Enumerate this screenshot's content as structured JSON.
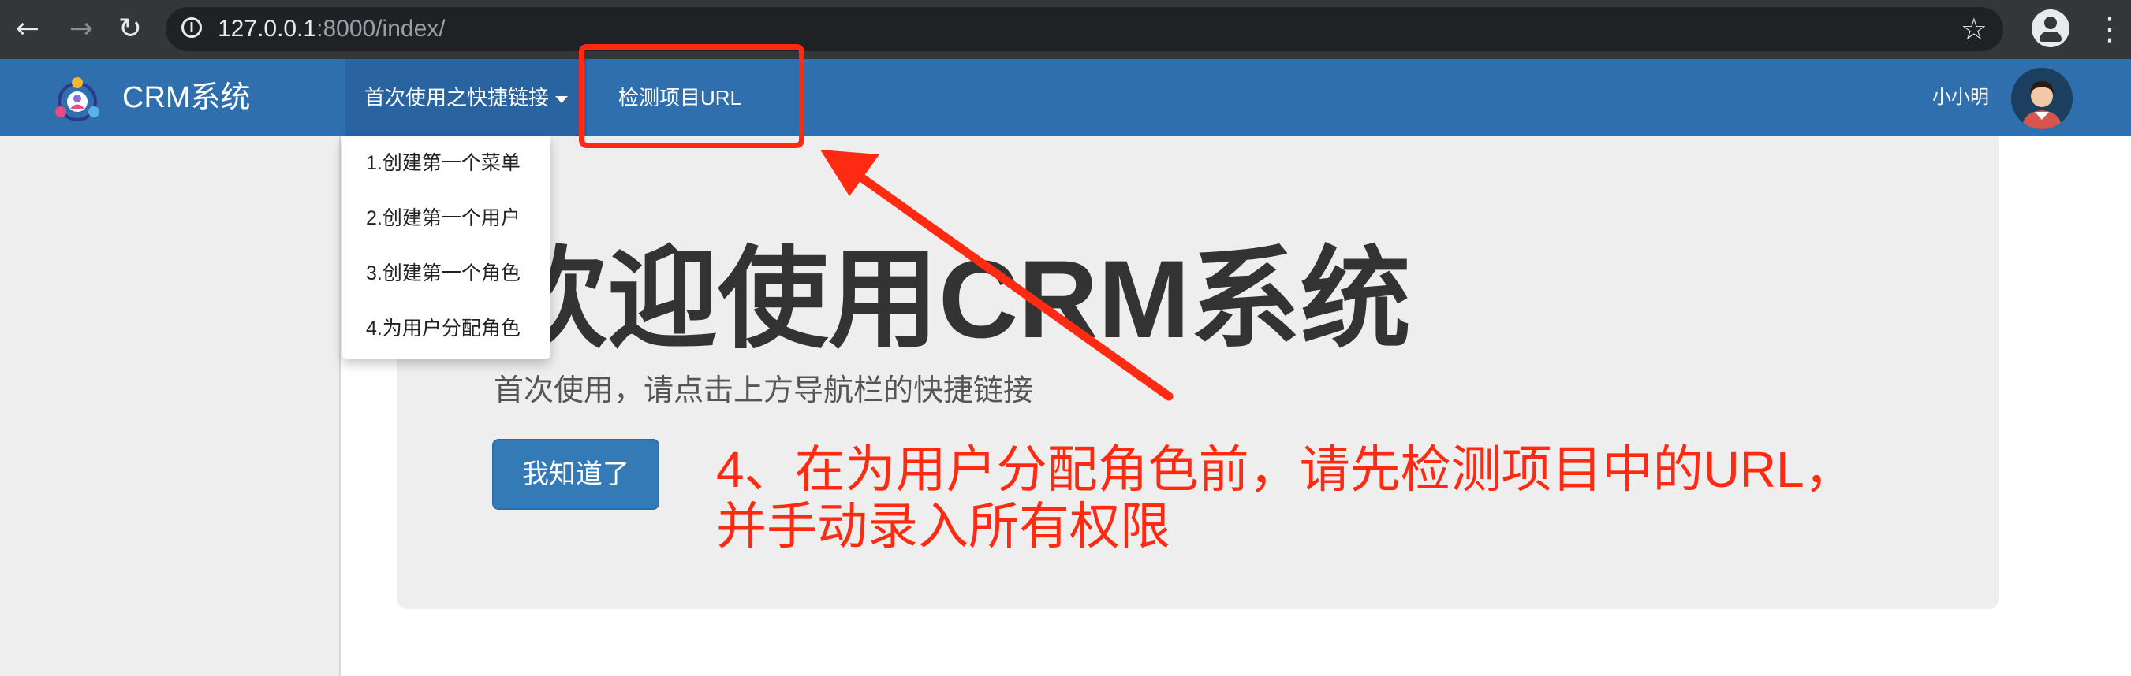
{
  "browser": {
    "url_host": "127.0.0.1",
    "url_rest": ":8000/index/",
    "icons": [
      "back-arrow-icon",
      "forward-arrow-icon",
      "reload-icon",
      "info-icon",
      "star-icon",
      "account-icon",
      "menu-dots-icon"
    ]
  },
  "navbar": {
    "brand": "CRM系统",
    "quick_links_label": "首次使用之快捷链接",
    "check_url_label": "检测项目URL",
    "user_name": "小小明",
    "bg_color": "#2f6fad"
  },
  "dropdown": {
    "items": [
      "1.创建第一个菜单",
      "2.创建第一个用户",
      "3.创建第一个角色",
      "4.为用户分配角色"
    ]
  },
  "jumbotron": {
    "title": "欢迎使用CRM系统",
    "subtitle": "首次使用，请点击上方导航栏的快捷链接",
    "button_label": "我知道了"
  },
  "annotation": {
    "line1": "4、在为用户分配角色前，请先检测项目中的URL，",
    "line2": "并手动录入所有权限",
    "color": "#ff2a12"
  }
}
